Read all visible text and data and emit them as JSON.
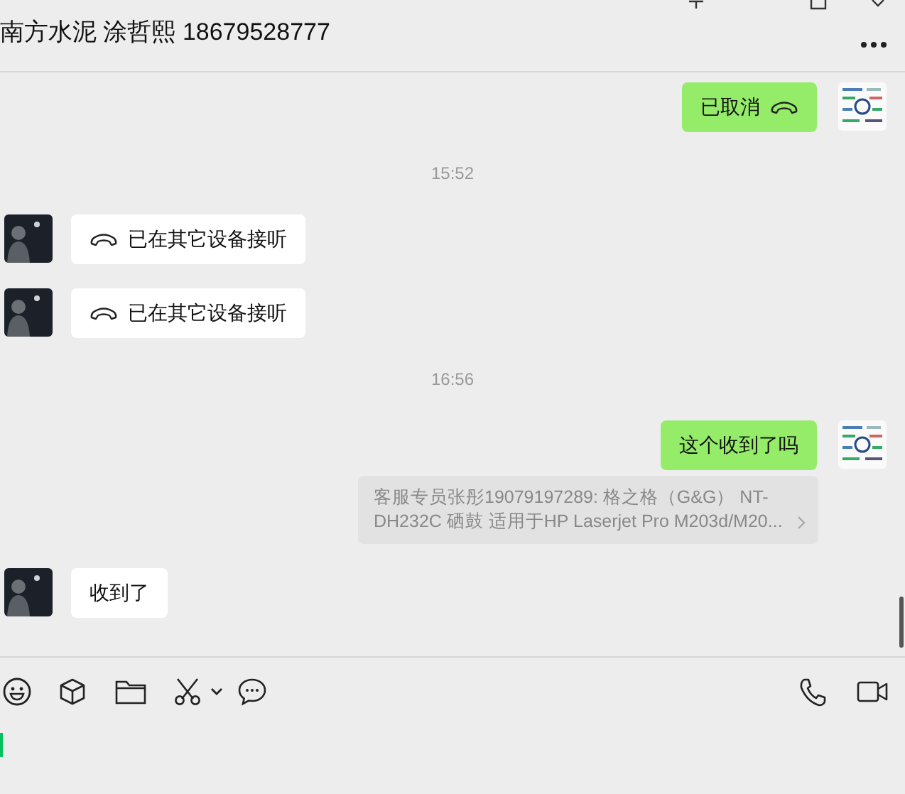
{
  "header": {
    "title": "南方水泥 涂哲熙 18679528777"
  },
  "messages": [
    {
      "kind": "call",
      "outgoing": true,
      "text": "已取消"
    },
    {
      "kind": "time",
      "text": "15:52"
    },
    {
      "kind": "call",
      "outgoing": false,
      "text": "已在其它设备接听"
    },
    {
      "kind": "call",
      "outgoing": false,
      "text": "已在其它设备接听"
    },
    {
      "kind": "time",
      "text": "16:56"
    },
    {
      "kind": "text",
      "outgoing": true,
      "text": "这个收到了吗"
    },
    {
      "kind": "quote",
      "text": "客服专员张彤19079197289: 格之格（G&G） NT-DH232C 硒鼓 适用于HP Laserjet Pro M203d/M20..."
    },
    {
      "kind": "text",
      "outgoing": false,
      "text": "收到了"
    }
  ]
}
